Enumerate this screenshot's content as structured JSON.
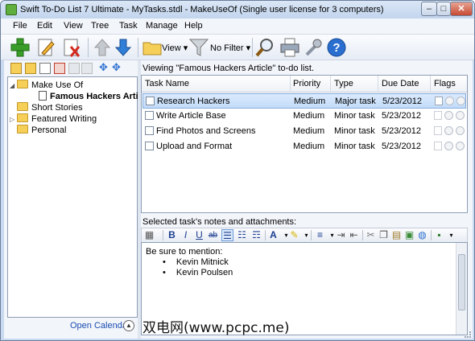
{
  "window": {
    "title": "Swift To-Do List 7 Ultimate - MyTasks.stdl - MakeUseOf (Single user license for 3 computers)",
    "controls": [
      "–",
      "□",
      "✕"
    ]
  },
  "menu": [
    "File",
    "Edit",
    "View",
    "Tree",
    "Task",
    "Manage",
    "Help"
  ],
  "toolbar": {
    "view_label": "View",
    "filter_label": "No Filter"
  },
  "tree": {
    "items": [
      {
        "label": "Make Use Of",
        "type": "folder"
      },
      {
        "label": "Famous Hackers Article",
        "type": "list"
      },
      {
        "label": "Short Stories",
        "type": "folder"
      },
      {
        "label": "Featured Writing",
        "type": "folder"
      },
      {
        "label": "Personal",
        "type": "folder"
      }
    ],
    "open_calendar": "Open Calendar"
  },
  "viewing_text": "Viewing \"Famous Hackers Article\" to-do list.",
  "grid": {
    "columns": [
      "Task Name",
      "Priority",
      "Type",
      "Due Date",
      "Flags"
    ],
    "rows": [
      {
        "name": "Research Hackers",
        "priority": "Medium",
        "type": "Major task",
        "due": "5/23/2012",
        "selected": true
      },
      {
        "name": "Write Article Base",
        "priority": "Medium",
        "type": "Minor task",
        "due": "5/23/2012",
        "selected": false
      },
      {
        "name": "Find Photos and Screens",
        "priority": "Medium",
        "type": "Minor task",
        "due": "5/23/2012",
        "selected": false
      },
      {
        "name": "Upload and Format",
        "priority": "Medium",
        "type": "Minor task",
        "due": "5/23/2012",
        "selected": false
      }
    ]
  },
  "notes": {
    "label": "Selected task's notes and attachments:",
    "format_buttons": [
      "B",
      "I",
      "U",
      "ab"
    ],
    "intro": "Be sure to mention:",
    "bullets": [
      "Kevin Mitnick",
      "Kevin Poulsen"
    ]
  },
  "watermark": "双电网(www.pcpc.me)",
  "colors": {
    "accent_blue": "#1b4db3",
    "selection": "#c3dcf9",
    "window_frame": "#c9daf0"
  }
}
